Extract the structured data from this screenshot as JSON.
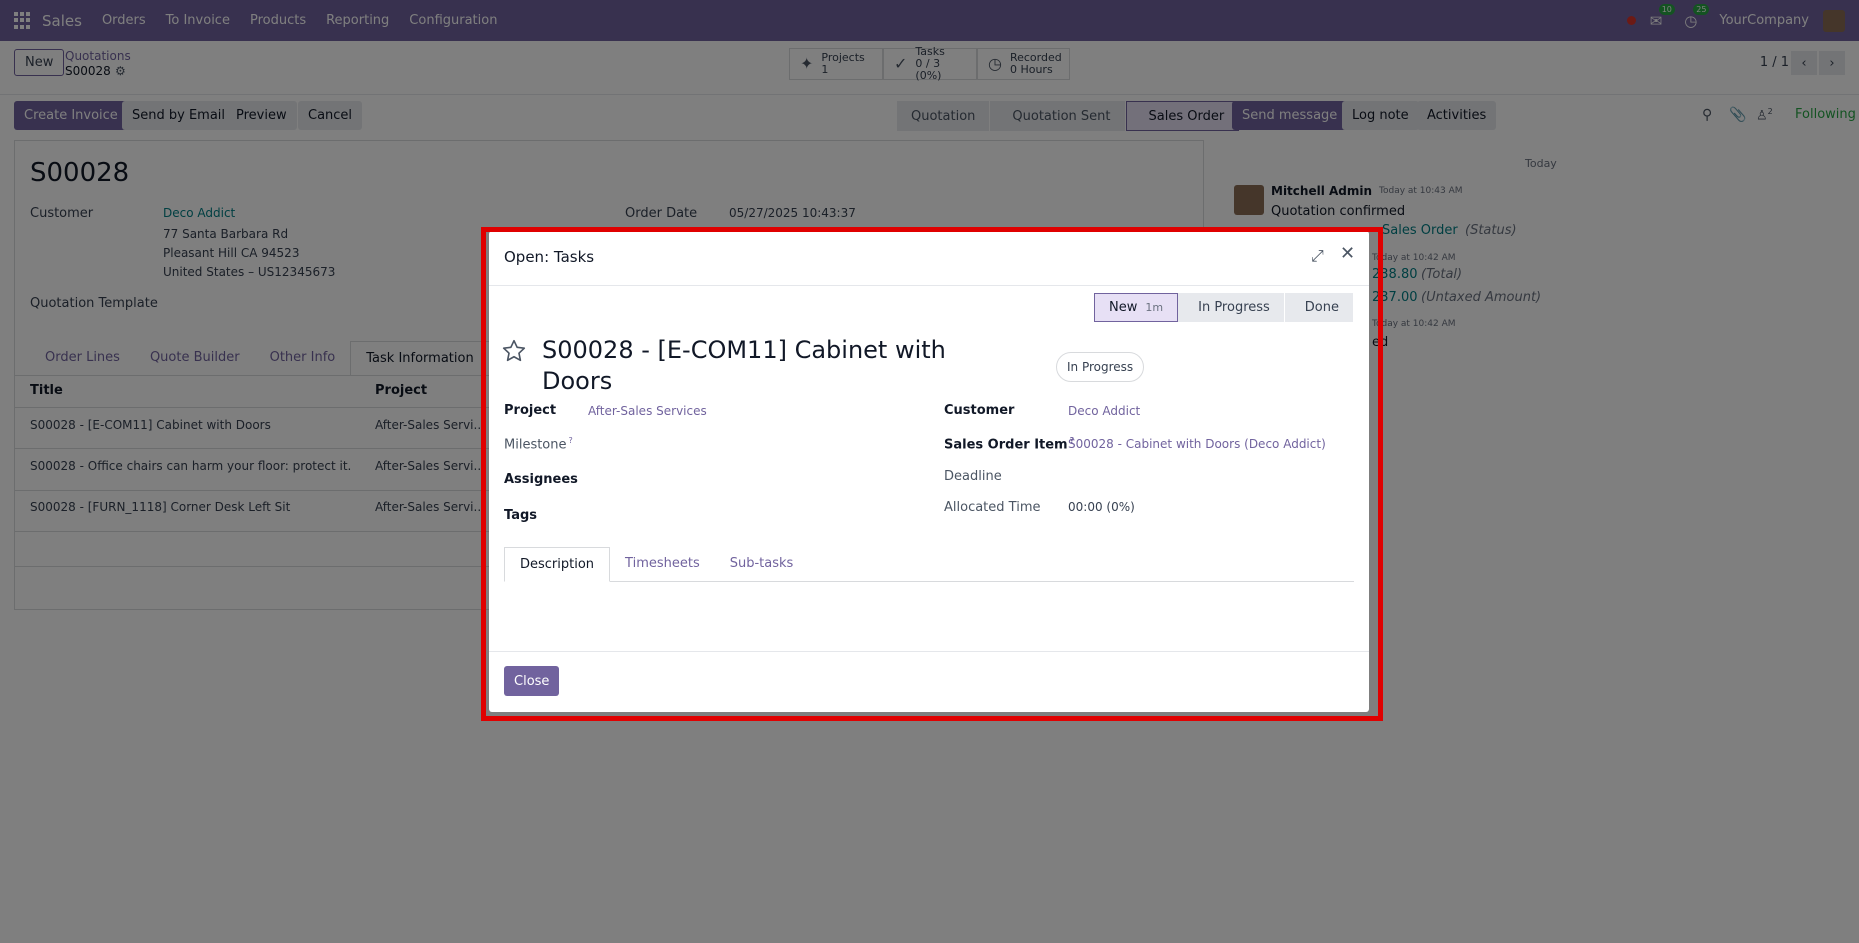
{
  "navbar": {
    "app_name": "Sales",
    "menu": [
      "Orders",
      "To Invoice",
      "Products",
      "Reporting",
      "Configuration"
    ],
    "messages_count": "10",
    "activities_count": "25",
    "company": "YourCompany"
  },
  "control_panel": {
    "new_label": "New",
    "breadcrumb_parent": "Quotations",
    "breadcrumb_current": "S00028",
    "smart_buttons": [
      {
        "label": "Projects",
        "value": "1",
        "icon": "puzzle-icon"
      },
      {
        "label": "Tasks",
        "value": "0 / 3 (0%)",
        "icon": "check-icon"
      },
      {
        "label": "Recorded",
        "value": "0 Hours",
        "icon": "clock-icon"
      }
    ],
    "pager": "1 / 1"
  },
  "actions": {
    "create_invoice": "Create Invoice",
    "send_by_email": "Send by Email",
    "preview": "Preview",
    "cancel": "Cancel"
  },
  "statusbar": [
    "Quotation",
    "Quotation Sent",
    "Sales Order"
  ],
  "form": {
    "title": "S00028",
    "customer_label": "Customer",
    "customer_name": "Deco Addict",
    "address_line1": "77 Santa Barbara Rd",
    "address_line2": "Pleasant Hill CA 94523",
    "address_line3": "United States – US12345673",
    "quotation_template_label": "Quotation Template",
    "order_date_label": "Order Date",
    "order_date_value": "05/27/2025 10:43:37",
    "tabs": [
      "Order Lines",
      "Quote Builder",
      "Other Info",
      "Task Information"
    ],
    "table_headers": [
      "Title",
      "Project"
    ],
    "rows": [
      {
        "title": "S00028 - [E-COM11] Cabinet with Doors",
        "project": "After-Sales Servi..."
      },
      {
        "title": "S00028 - Office chairs can harm your floor: protect it.",
        "project": "After-Sales Servi..."
      },
      {
        "title": "S00028 - [FURN_1118] Corner Desk Left Sit",
        "project": "After-Sales Servi..."
      }
    ]
  },
  "chatter": {
    "send_message": "Send message",
    "log_note": "Log note",
    "activities": "Activities",
    "followers_count": "2",
    "following": "Following",
    "date_separator": "Today",
    "author": "Mitchell Admin",
    "time1": "Today at 10:43 AM",
    "message": "Quotation confirmed",
    "tracking_value1": "Sales Order",
    "tracking_field1": "(Status)",
    "time2": "Today at 10:42 AM",
    "tracking_value2": "238.80",
    "tracking_field2": "(Total)",
    "tracking_value3": "237.00",
    "tracking_field3": "(Untaxed Amount)",
    "time3": "Today at 10:42 AM",
    "fragment": "ed"
  },
  "dialog": {
    "title": "Open: Tasks",
    "stages": [
      {
        "label": "New",
        "sub": "1m"
      },
      {
        "label": "In Progress"
      },
      {
        "label": "Done"
      }
    ],
    "task_title": "S00028 - [E-COM11] Cabinet with Doors",
    "state": "In Progress",
    "project_label": "Project",
    "project_value": "After-Sales Services",
    "milestone_label": "Milestone",
    "assignees_label": "Assignees",
    "tags_label": "Tags",
    "customer_label": "Customer",
    "customer_value": "Deco Addict",
    "sales_order_item_label": "Sales Order Item",
    "sales_order_item_value": "S00028 - Cabinet with Doors (Deco Addict)",
    "deadline_label": "Deadline",
    "allocated_time_label": "Allocated Time",
    "allocated_time_value": "00:00 (0%)",
    "tabs": [
      "Description",
      "Timesheets",
      "Sub-tasks"
    ],
    "close_label": "Close",
    "help_mark": "?"
  }
}
